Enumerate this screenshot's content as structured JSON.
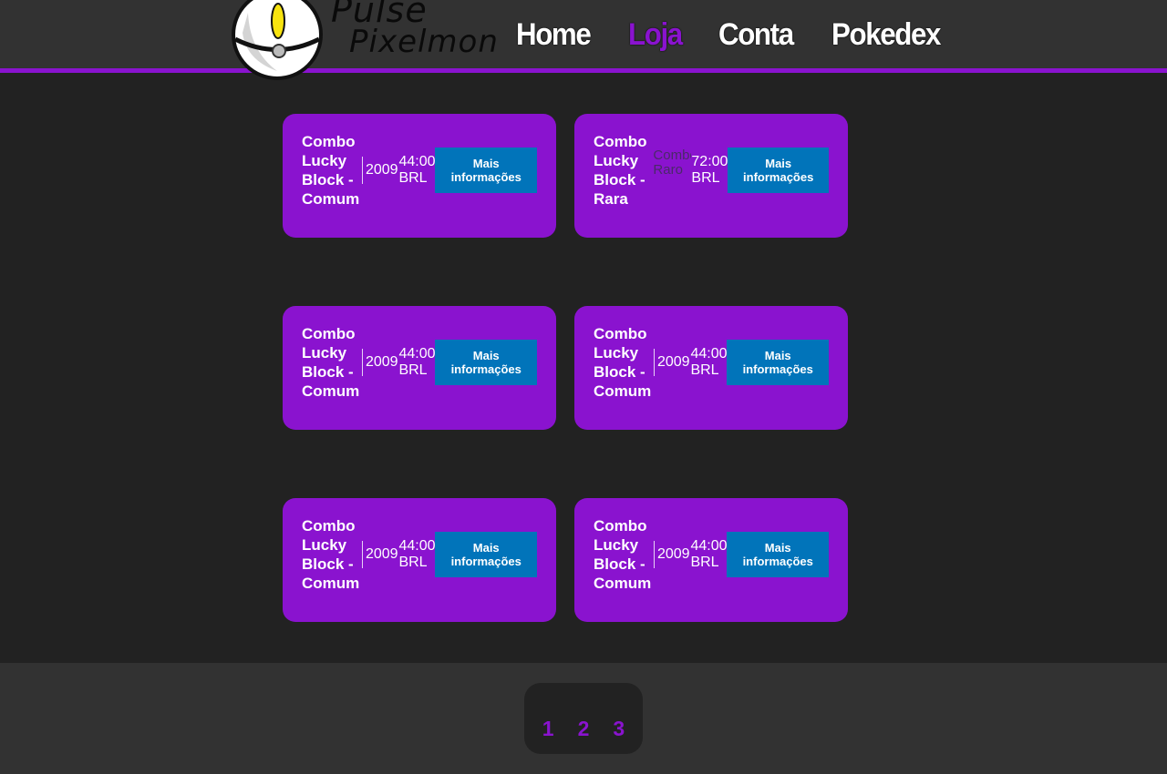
{
  "logo": {
    "line1": "Pulse",
    "line2": "Pixelmon"
  },
  "nav": {
    "items": [
      {
        "label": "Home",
        "active": false
      },
      {
        "label": "Loja",
        "active": true
      },
      {
        "label": "Conta",
        "active": false
      },
      {
        "label": "Pokedex",
        "active": false
      }
    ]
  },
  "products": [
    {
      "name": "Combo Lucky Block - Comum",
      "year": "2009",
      "price": "44:00 BRL",
      "image_alt": "",
      "button": "Mais informações"
    },
    {
      "name": "Combo Lucky Block - Rara",
      "year": "",
      "price": "72:00 BRL",
      "image_alt": "Combo Raro",
      "button": "Mais informações"
    },
    {
      "name": "Combo Lucky Block - Comum",
      "year": "2009",
      "price": "44:00 BRL",
      "image_alt": "",
      "button": "Mais informações"
    },
    {
      "name": "Combo Lucky Block - Comum",
      "year": "2009",
      "price": "44:00 BRL",
      "image_alt": "",
      "button": "Mais informações"
    },
    {
      "name": "Combo Lucky Block - Comum",
      "year": "2009",
      "price": "44:00 BRL",
      "image_alt": "",
      "button": "Mais informações"
    },
    {
      "name": "Combo Lucky Block - Comum",
      "year": "2009",
      "price": "44:00 BRL",
      "image_alt": "",
      "button": "Mais informações"
    }
  ],
  "pagination": {
    "pages": [
      "1",
      "2",
      "3"
    ]
  },
  "colors": {
    "accent": "#8a13cf",
    "button": "#0174ba",
    "background": "#222222",
    "header": "#323232"
  },
  "icons": {
    "logo": "pokeball-icon"
  }
}
